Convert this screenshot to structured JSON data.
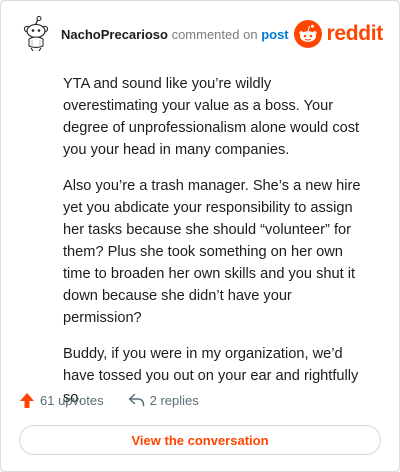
{
  "header": {
    "author": "NachoPrecarioso",
    "action_text": "commented on",
    "post_link": "post",
    "brand_name": "reddit",
    "brand_color": "#ff4500"
  },
  "comment": {
    "paragraphs": [
      "YTA and sound like you’re wildly overestimating your value as a boss. Your degree of unprofessionalism alone would cost you your head in many companies.",
      "Also you’re a trash manager. She’s a new hire yet you abdicate your responsibility to assign her tasks because she should “volunteer” for them? Plus she took something on her own time to broaden her own skills and you shut it down because she didn’t have your permission?",
      "Buddy, if you were in my organization, we’d have tossed you out on your ear and rightfully so."
    ]
  },
  "footer": {
    "upvotes": "61 upvotes",
    "replies": "2 replies",
    "upvote_icon": "upvote-arrow-icon",
    "reply_icon": "reply-arrow-icon"
  },
  "cta": {
    "label": "View the conversation"
  }
}
